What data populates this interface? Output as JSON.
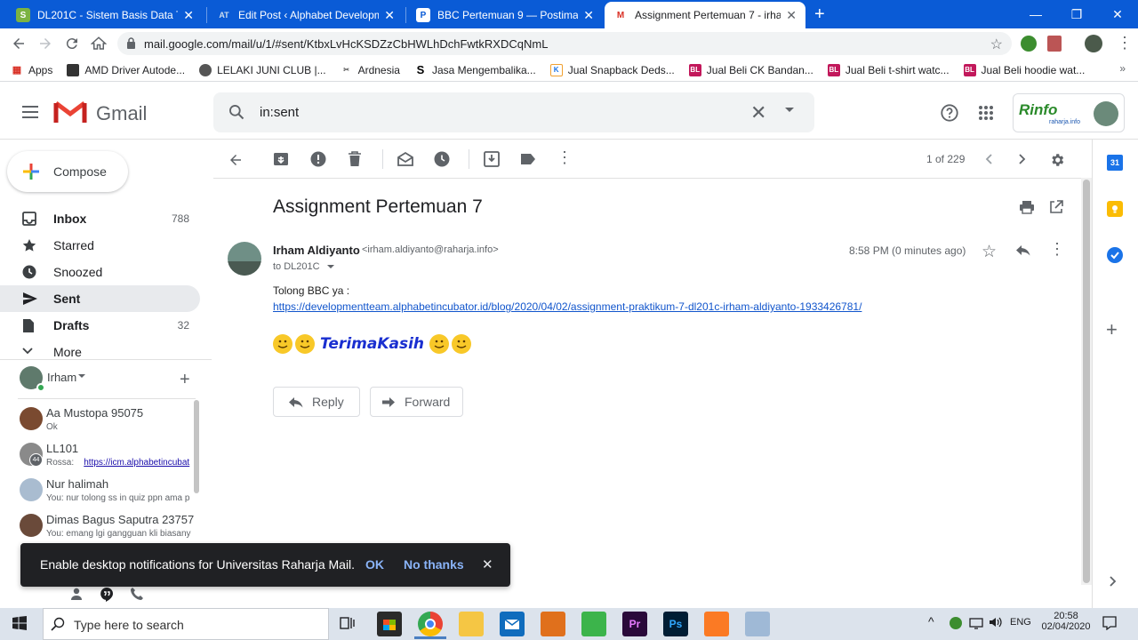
{
  "browser": {
    "tabs": [
      {
        "title": "DL201C - Sistem Basis Data TA. 2",
        "favicon": "S"
      },
      {
        "title": "Edit Post ‹ Alphabet Developmen",
        "favicon": "AT"
      },
      {
        "title": "BBC Pertemuan 9 — Postimage.o",
        "favicon": "P"
      },
      {
        "title": "Assignment Pertemuan 7 - irham",
        "favicon": "M"
      }
    ],
    "url": "mail.google.com/mail/u/1/#sent/KtbxLvHcKSDZzCbHWLhDchFwtkRXDCqNmL",
    "bookmarks": [
      "Apps",
      "AMD Driver Autode...",
      "LELAKI JUNI CLUB |...",
      "Ardnesia",
      "Jasa Mengembalika...",
      "Jual Snapback Deds...",
      "Jual Beli CK Bandan...",
      "Jual Beli t-shirt watc...",
      "Jual Beli hoodie wat..."
    ],
    "bookmark_icons": [
      "BL",
      "BL",
      "BL"
    ]
  },
  "gmail": {
    "logo": "Gmail",
    "search_value": "in:sent",
    "org_logo_text": "Rinfo",
    "org_logo_sub": "raharja.info",
    "compose": "Compose",
    "nav": [
      {
        "label": "Inbox",
        "count": "788"
      },
      {
        "label": "Starred",
        "count": ""
      },
      {
        "label": "Snoozed",
        "count": ""
      },
      {
        "label": "Sent",
        "count": ""
      },
      {
        "label": "Drafts",
        "count": "32"
      },
      {
        "label": "More",
        "count": ""
      }
    ],
    "hangouts_user": "Irham",
    "chats": [
      {
        "name": "Aa Mustopa 95075",
        "preview": "Ok",
        "badge": ""
      },
      {
        "name": "LL101",
        "preview": "Rossa:",
        "link": "https://icm.alphabetincubat",
        "badge": "44"
      },
      {
        "name": "Nur halimah",
        "preview": "You: nur tolong ss in quiz ppn ama p",
        "badge": ""
      },
      {
        "name": "Dimas Bagus Saputra 23757",
        "preview": "You: emang lgi gangguan kli biasany",
        "badge": ""
      }
    ],
    "pager": "1 of 229",
    "email": {
      "subject": "Assignment Pertemuan 7",
      "sender_name": "Irham Aldiyanto",
      "sender_email": "<irham.aldiyanto@raharja.info>",
      "to": "to DL201C",
      "time": "8:58 PM (0 minutes ago)",
      "body_line": "Tolong BBC ya :",
      "link": "https://developmentteam.alphabetincubator.id/blog/2020/04/02/assignment-praktikum-7-dl201c-irham-aldiyanto-1933426781/",
      "sign": "TerimaKasih"
    },
    "reply": "Reply",
    "forward": "Forward",
    "notification": {
      "text": "Enable desktop notifications for Universitas Raharja Mail.",
      "ok": "OK",
      "no": "No thanks"
    }
  },
  "taskbar": {
    "search": "Type here to search",
    "lang": "ENG",
    "time": "20:58",
    "date": "02/04/2020"
  }
}
